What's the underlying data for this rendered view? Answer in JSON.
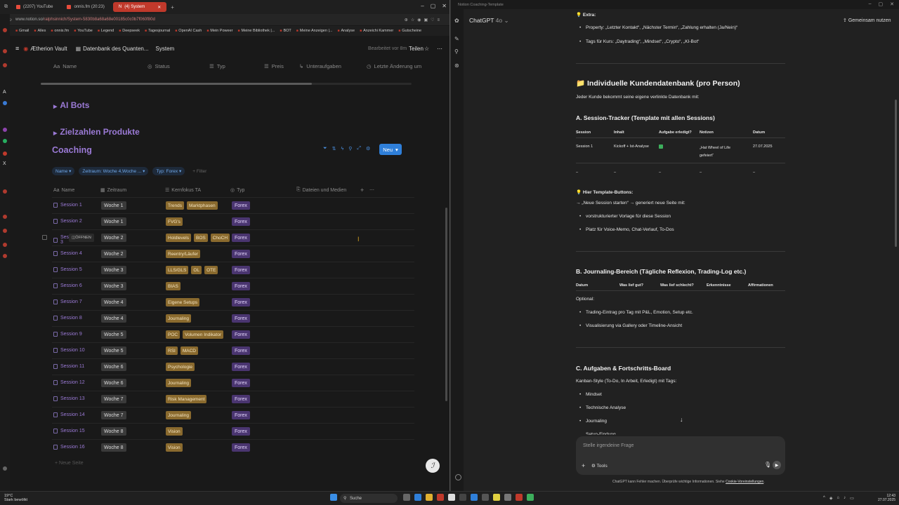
{
  "left_browser": {
    "tabs": [
      {
        "label": "(2207) YouTube",
        "active": false
      },
      {
        "label": "onnis.fm (20:23)",
        "active": false
      },
      {
        "label": "(4) System",
        "active": true
      }
    ],
    "url_prefix": "www.notion.so/",
    "url_rest": "ralphsinnich/System-5830b8a68a68e00185c0c0b7f060f80d",
    "bookmarks": [
      "Gmail",
      "Alles",
      "onnis.fm",
      "YouTube",
      "Legend",
      "Deepseek",
      "Tagesjournal",
      "OpenAI Cash",
      "Mein Poweer",
      "Meine Bibliothek |...",
      "BOT",
      "Meine Anzeigen |...",
      "Analyse",
      "Anzeichi Kammer",
      "Gutscheine"
    ]
  },
  "notion": {
    "workspace": "Ætherion Vault",
    "breadcrumb_1": "Datenbank des Quanten...",
    "breadcrumb_2": "System",
    "edited": "Bearbeitet vor 8m",
    "share": "Teilen",
    "top_columns": [
      "Name",
      "Status",
      "Typ",
      "Preis",
      "Unteraufgaben",
      "Letzte Änderung um"
    ],
    "groups": [
      "AI Bots",
      "Zielzahlen Produkte"
    ],
    "db_title": "Coaching",
    "new_button": "Neu",
    "filters": [
      "Name",
      "Zeitraum: Woche 4,Woche ...",
      "Typ: Forex",
      "Filter"
    ],
    "columns": [
      "Name",
      "Zeitraum",
      "Kernfokus TA",
      "Typ",
      "Dateien und Medien"
    ],
    "open_label": "ÖFFNEN",
    "rows": [
      {
        "name": "Session 1",
        "zeit": "Woche 1",
        "tags": [
          "Trends",
          "Marktphasen"
        ],
        "typ": "Forex"
      },
      {
        "name": "Session 2",
        "zeit": "Woche 1",
        "tags": [
          "FVG's"
        ],
        "typ": "Forex"
      },
      {
        "name": "Session 3",
        "zeit": "Woche 2",
        "tags": [
          "Holdlevels",
          "BOS",
          "ChoCH"
        ],
        "typ": "Forex"
      },
      {
        "name": "Session 4",
        "zeit": "Woche 2",
        "tags": [
          "Reentry/Läufer"
        ],
        "typ": "Forex"
      },
      {
        "name": "Session 5",
        "zeit": "Woche 3",
        "tags": [
          "LLS/GLS",
          "OL",
          "OTE"
        ],
        "typ": "Forex"
      },
      {
        "name": "Session 6",
        "zeit": "Woche 3",
        "tags": [
          "BIAS"
        ],
        "typ": "Forex"
      },
      {
        "name": "Session 7",
        "zeit": "Woche 4",
        "tags": [
          "Eigene Setups"
        ],
        "typ": "Forex"
      },
      {
        "name": "Session 8",
        "zeit": "Woche 4",
        "tags": [
          "Journaling"
        ],
        "typ": "Forex"
      },
      {
        "name": "Session 9",
        "zeit": "Woche 5",
        "tags": [
          "POC",
          "Volumen Indikator"
        ],
        "typ": "Forex"
      },
      {
        "name": "Session 10",
        "zeit": "Woche 5",
        "tags": [
          "RSI",
          "MACD"
        ],
        "typ": "Forex"
      },
      {
        "name": "Session 11",
        "zeit": "Woche 6",
        "tags": [
          "Psychologie"
        ],
        "typ": "Forex"
      },
      {
        "name": "Session 12",
        "zeit": "Woche 6",
        "tags": [
          "Journaling"
        ],
        "typ": "Forex"
      },
      {
        "name": "Session 13",
        "zeit": "Woche 7",
        "tags": [
          "Risk Management"
        ],
        "typ": "Forex"
      },
      {
        "name": "Session 14",
        "zeit": "Woche 7",
        "tags": [
          "Journaling"
        ],
        "typ": "Forex"
      },
      {
        "name": "Session 15",
        "zeit": "Woche 8",
        "tags": [
          "Vision"
        ],
        "typ": "Forex"
      },
      {
        "name": "Session 16",
        "zeit": "Woche 8",
        "tags": [
          "Vision"
        ],
        "typ": "Forex"
      }
    ],
    "new_page": "+ Neue Seite"
  },
  "chatgpt": {
    "window_title": "Notion Coaching-Template",
    "model": "ChatGPT",
    "model_version": "4o",
    "share": "Gemeinsam nutzen",
    "extra_heading": "Extra:",
    "extra_bullets": [
      "Property: „Letzter Kontakt“, „Nächster Termin“, „Zahlung erhalten (Ja/Nein)“",
      "Tags für Kurs: „Daytrading“, „Mindset“, „Crypto“, „KI-Bot“"
    ],
    "h2": "Individuelle Kundendatenbank (pro Person)",
    "intro": "Jeder Kunde bekommt seine eigene verlinkte Datenbank mit:",
    "a_heading": "A. Session-Tracker (Template mit allen Sessions)",
    "a_table_head": [
      "Session",
      "Inhalt",
      "Aufgabe erledigt?",
      "Notizen",
      "Datum"
    ],
    "a_table_row": [
      "Session 1",
      "Kickoff + Ist-Analyse",
      "",
      "„Hat Wheel of Life gefeiert“",
      "27.07.2025"
    ],
    "a_table_dash": [
      "–",
      "–",
      "–",
      "–",
      "–"
    ],
    "buttons_heading": "Hier Template-Buttons:",
    "buttons_line": "→ „Neue Session starten“ → generiert neue Seite mit:",
    "buttons_bullets": [
      "vorstrukturierter Vorlage für diese Session",
      "Platz für Voice-Memo, Chat-Verlauf, To-Dos"
    ],
    "b_heading": "B. Journaling-Bereich (Tägliche Reflexion, Trading-Log etc.)",
    "b_table_head": [
      "Datum",
      "Was lief gut?",
      "Was lief schlecht?",
      "Erkenntnisse",
      "Affirmationen"
    ],
    "optional": "Optional:",
    "b_bullets": [
      "Trading-Eintrag pro Tag mit P&L, Emotion, Setup etc.",
      "Visualisierung via Gallery oder Timeline-Ansicht"
    ],
    "c_heading": "C. Aufgaben & Fortschritts-Board",
    "c_line": "Kanban-Style (To-Do, In Arbeit, Erledigt) mit Tags:",
    "c_bullets": [
      "Mindset",
      "Technische Analyse",
      "Journaling",
      "Setup-Findung"
    ],
    "input_placeholder": "Stelle irgendeine Frage",
    "tools": "Tools",
    "disclaimer_pre": "ChatGPT kann Fehler machen. Überprüfe wichtige Informationen. Siehe ",
    "disclaimer_link": "Cookie-Voreinstellungen",
    "disclaimer_post": "."
  },
  "taskbar": {
    "weather_temp": "19°C",
    "weather_text": "Stark bewölkt",
    "search": "Suche",
    "time": "12:43",
    "date": "27.07.2025"
  },
  "colors": {
    "notion_purple": "#9b7ad6",
    "tag_brown": "#8a6a2e",
    "typ_purple": "#4a3570",
    "accent_blue": "#2f7fd9",
    "check_green": "#3dae5c"
  }
}
